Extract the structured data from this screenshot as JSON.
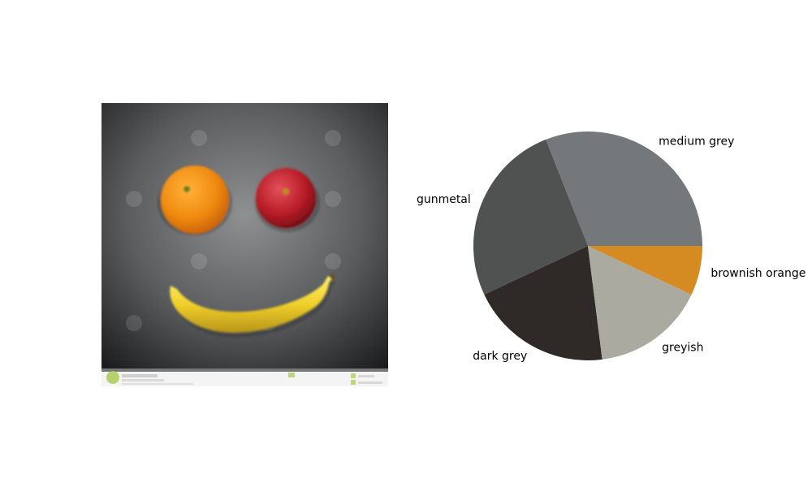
{
  "photo": {
    "subject": "fruit smiley face on dark background",
    "elements": [
      "orange-left-eye",
      "red-apple-right-eye",
      "banana-smile"
    ]
  },
  "chart_data": {
    "type": "pie",
    "title": "",
    "start_angle_deg": 0,
    "direction": "counterclockwise",
    "labels": [
      "medium grey",
      "gunmetal",
      "dark grey",
      "greyish",
      "brownish orange"
    ],
    "values": [
      31,
      26,
      20,
      16,
      7
    ],
    "colors": [
      "#75787b",
      "#505151",
      "#2f2a28",
      "#abaaa0",
      "#d68a22"
    ]
  }
}
